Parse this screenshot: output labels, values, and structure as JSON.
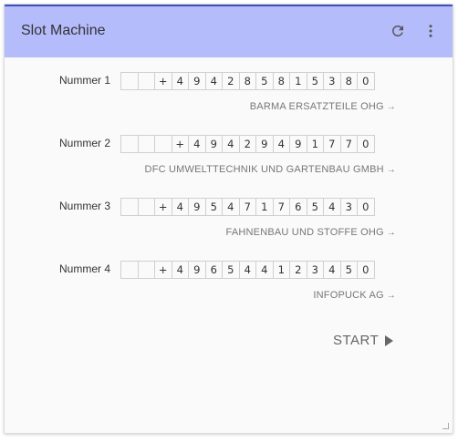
{
  "header": {
    "title": "Slot Machine"
  },
  "rows": [
    {
      "label": "Nummer 1",
      "digits": [
        "",
        "",
        "+",
        "4",
        "9",
        "4",
        "2",
        "8",
        "5",
        "8",
        "1",
        "5",
        "3",
        "8",
        "0"
      ],
      "company": "BARMA ERSATZTEILE OHG"
    },
    {
      "label": "Nummer 2",
      "digits": [
        "",
        "",
        "",
        "+",
        "4",
        "9",
        "4",
        "2",
        "9",
        "4",
        "9",
        "1",
        "7",
        "7",
        "0"
      ],
      "company": "DFC UMWELTTECHNIK UND GARTENBAU GMBH"
    },
    {
      "label": "Nummer 3",
      "digits": [
        "",
        "",
        "+",
        "4",
        "9",
        "5",
        "4",
        "7",
        "1",
        "7",
        "6",
        "5",
        "4",
        "3",
        "0"
      ],
      "company": "FAHNENBAU UND STOFFE OHG"
    },
    {
      "label": "Nummer 4",
      "digits": [
        "",
        "",
        "+",
        "4",
        "9",
        "6",
        "5",
        "4",
        "4",
        "1",
        "2",
        "3",
        "4",
        "5",
        "0"
      ],
      "company": "INFOPUCK AG"
    }
  ],
  "start": {
    "label": "START"
  },
  "icons": {
    "refresh": "refresh-icon",
    "more": "more-vertical-icon",
    "arrow": "arrow-right-icon",
    "play": "play-icon"
  },
  "colors": {
    "header_bg": "#b4bcfb",
    "header_border": "#3f51b5"
  }
}
